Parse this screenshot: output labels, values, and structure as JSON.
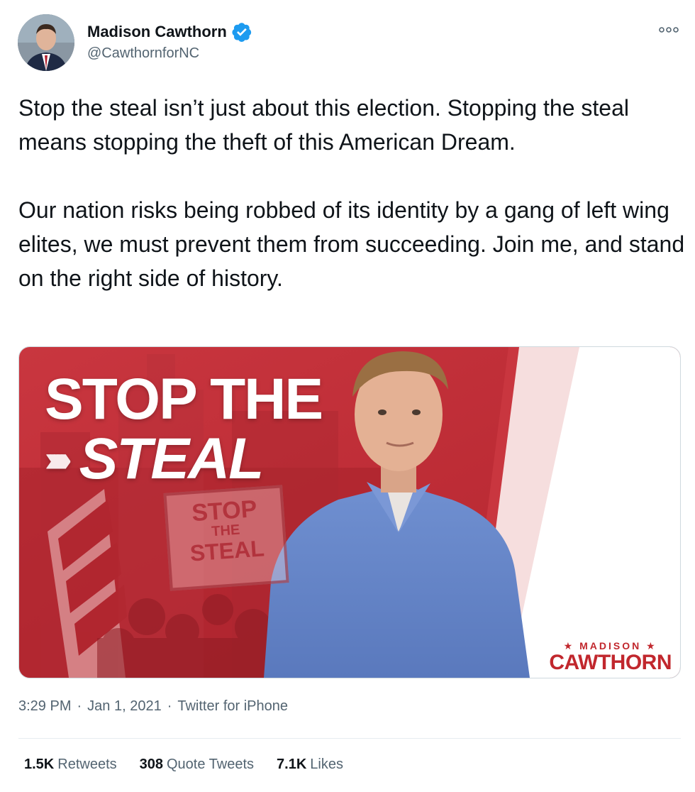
{
  "author": {
    "name": "Madison Cawthorn",
    "handle": "@CawthornforNC",
    "verified": true
  },
  "tweet": {
    "paragraph1": "Stop the steal isn’t just about this election. Stopping the steal means stopping the theft of this American Dream.",
    "paragraph2": "Our nation risks being robbed of its identity by a gang of left wing elites, we must prevent them from succeeding. Join me, and stand on the right side of history."
  },
  "media": {
    "headline_line1": "STOP THE",
    "headline_chevrons": "›››››",
    "headline_line2": "STEAL",
    "sign_line1": "STOP",
    "sign_line2": "THE",
    "sign_line3": "STEAL",
    "brand_top": "★ MADISON ★",
    "brand_bottom": "CAWTHORN"
  },
  "meta": {
    "time": "3:29 PM",
    "sep1": "·",
    "date": "Jan 1, 2021",
    "sep2": "·",
    "source": "Twitter for iPhone"
  },
  "stats": {
    "retweets_count": "1.5K",
    "retweets_label": "Retweets",
    "quotes_count": "308",
    "quotes_label": "Quote Tweets",
    "likes_count": "7.1K",
    "likes_label": "Likes"
  },
  "icons": {
    "verified": "verified-badge-icon",
    "more": "more-dots-icon"
  },
  "colors": {
    "verified_blue": "#1d9bf0",
    "banner_red": "#c7333c",
    "brand_red": "#c1272d",
    "secondary_text": "#536471"
  }
}
